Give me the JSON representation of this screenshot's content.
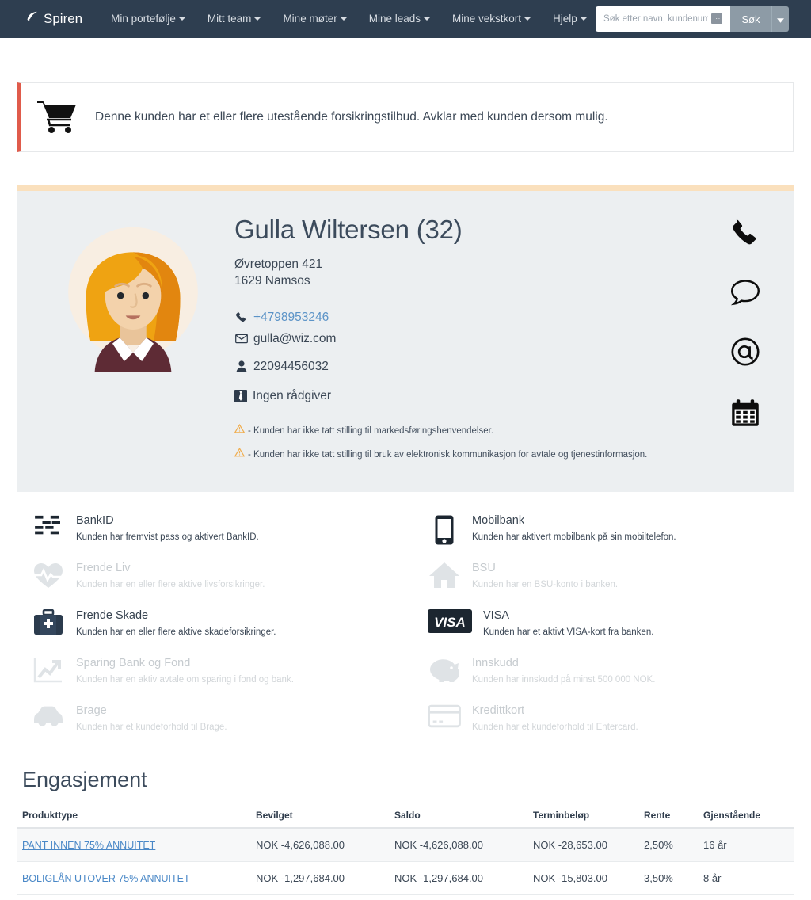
{
  "navbar": {
    "brand": "Spiren",
    "brand_icon": "leaf-icon",
    "links": [
      {
        "label": "Min portefølje",
        "has_caret": true
      },
      {
        "label": "Mitt team",
        "has_caret": true
      },
      {
        "label": "Mine møter",
        "has_caret": true
      },
      {
        "label": "Mine leads",
        "has_caret": true
      },
      {
        "label": "Mine vekstkort",
        "has_caret": true
      },
      {
        "label": "Hjelp",
        "has_caret": true
      }
    ],
    "search": {
      "placeholder": "Søk etter navn, kundenummer",
      "value": "",
      "badge": "···",
      "button_label": "Søk"
    },
    "bg_color": "#2e3e50"
  },
  "alert": {
    "icon": "shopping-cart-icon",
    "message": "Denne kunden har et eller flere utestående forsikringstilbud. Avklar med kunden dersom mulig.",
    "accent_color": "#e05b4b"
  },
  "profile": {
    "accent_bar_color": "#fae0bd",
    "background": "#eceff1",
    "avatar": "female-avatar-illustration",
    "name": "Gulla Wiltersen (32)",
    "address_line1": "Øvretoppen 421",
    "address_line2": "1629 Namsos",
    "phone": "+4798953246",
    "phone_color": "#5b93c7",
    "email": "gulla@wiz.com",
    "ssn": "22094456032",
    "advisor": "Ingen rådgiver",
    "warnings": [
      "- Kunden har ikke tatt stilling til markedsføringshenvendelser.",
      "- Kunden har ikke tatt stilling til bruk av elektronisk kommunikasjon for avtale og tjenestinformasjon."
    ],
    "actions": [
      {
        "name": "phone-icon",
        "label": "Ring kunde"
      },
      {
        "name": "speech-bubble-icon",
        "label": "Send SMS"
      },
      {
        "name": "at-sign-icon",
        "label": "Send e-post"
      },
      {
        "name": "calendar-icon",
        "label": "Avtale møte"
      }
    ]
  },
  "features": [
    {
      "icon": "bankid-icon",
      "title": "BankID",
      "desc": "Kunden har fremvist pass og aktivert BankID.",
      "active": true
    },
    {
      "icon": "mobile-phone-icon",
      "title": "Mobilbank",
      "desc": "Kunden har aktivert mobilbank på sin mobiltelefon.",
      "active": true
    },
    {
      "icon": "heart-pulse-icon",
      "title": "Frende Liv",
      "desc": "Kunden har en eller flere aktive livsforsikringer.",
      "active": false
    },
    {
      "icon": "house-icon",
      "title": "BSU",
      "desc": "Kunden har en BSU-konto i banken.",
      "active": false
    },
    {
      "icon": "first-aid-kit-icon",
      "title": "Frende Skade",
      "desc": "Kunden har en eller flere aktive skadeforsikringer.",
      "active": true
    },
    {
      "icon": "visa-logo-icon",
      "title": "VISA",
      "desc": "Kunden har et aktivt VISA-kort fra banken.",
      "active": true
    },
    {
      "icon": "chart-growth-icon",
      "title": "Sparing Bank og Fond",
      "desc": "Kunden har en aktiv avtale om sparing i fond og bank.",
      "active": false
    },
    {
      "icon": "piggy-bank-icon",
      "title": "Innskudd",
      "desc": "Kunden har innskudd på minst 500 000 NOK.",
      "active": false
    },
    {
      "icon": "car-icon",
      "title": "Brage",
      "desc": "Kunden har et kundeforhold til Brage.",
      "active": false
    },
    {
      "icon": "credit-card-icon",
      "title": "Kredittkort",
      "desc": "Kunden har et kundeforhold til Entercard.",
      "active": false
    }
  ],
  "engagement": {
    "title": "Engasjement",
    "columns": [
      "Produkttype",
      "Bevilget",
      "Saldo",
      "Terminbeløp",
      "Rente",
      "Gjenstående"
    ],
    "rows": [
      {
        "produkttype": "PANT INNEN 75% ANNUITET",
        "bevilget": "NOK -4,626,088.00",
        "saldo": "NOK -4,626,088.00",
        "terminbelop": "NOK -28,653.00",
        "rente": "2,50%",
        "gjenstaende": "16 år"
      },
      {
        "produkttype": "BOLIGLÅN UTOVER 75% ANNUITET",
        "bevilget": "NOK -1,297,684.00",
        "saldo": "NOK -1,297,684.00",
        "terminbelop": "NOK -15,803.00",
        "rente": "3,50%",
        "gjenstaende": "8 år"
      }
    ]
  }
}
